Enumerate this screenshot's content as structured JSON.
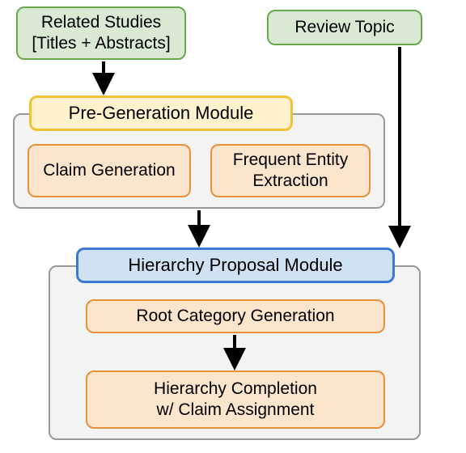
{
  "inputs": {
    "related_studies": "Related Studies\n[Titles + Abstracts]",
    "review_topic": "Review Topic"
  },
  "pregen": {
    "title": "Pre-Generation Module",
    "claim_gen": "Claim Generation",
    "freq_entity": "Frequent Entity\nExtraction"
  },
  "hierarchy": {
    "title": "Hierarchy Proposal Module",
    "root_cat": "Root Category Generation",
    "completion": "Hierarchy Completion\nw/ Claim Assignment"
  },
  "chart_data": {
    "type": "flowchart",
    "nodes": [
      {
        "id": "related_studies",
        "label": "Related Studies [Titles + Abstracts]",
        "type": "input"
      },
      {
        "id": "review_topic",
        "label": "Review Topic",
        "type": "input"
      },
      {
        "id": "pregen_module",
        "label": "Pre-Generation Module",
        "type": "module",
        "children": [
          "claim_gen",
          "freq_entity"
        ]
      },
      {
        "id": "claim_gen",
        "label": "Claim Generation",
        "type": "sub"
      },
      {
        "id": "freq_entity",
        "label": "Frequent Entity Extraction",
        "type": "sub"
      },
      {
        "id": "hierarchy_module",
        "label": "Hierarchy Proposal Module",
        "type": "module",
        "children": [
          "root_cat",
          "completion"
        ]
      },
      {
        "id": "root_cat",
        "label": "Root Category Generation",
        "type": "sub"
      },
      {
        "id": "completion",
        "label": "Hierarchy Completion w/ Claim Assignment",
        "type": "sub"
      }
    ],
    "edges": [
      {
        "from": "related_studies",
        "to": "pregen_module"
      },
      {
        "from": "pregen_module",
        "to": "hierarchy_module"
      },
      {
        "from": "review_topic",
        "to": "hierarchy_module"
      },
      {
        "from": "root_cat",
        "to": "completion"
      }
    ]
  }
}
